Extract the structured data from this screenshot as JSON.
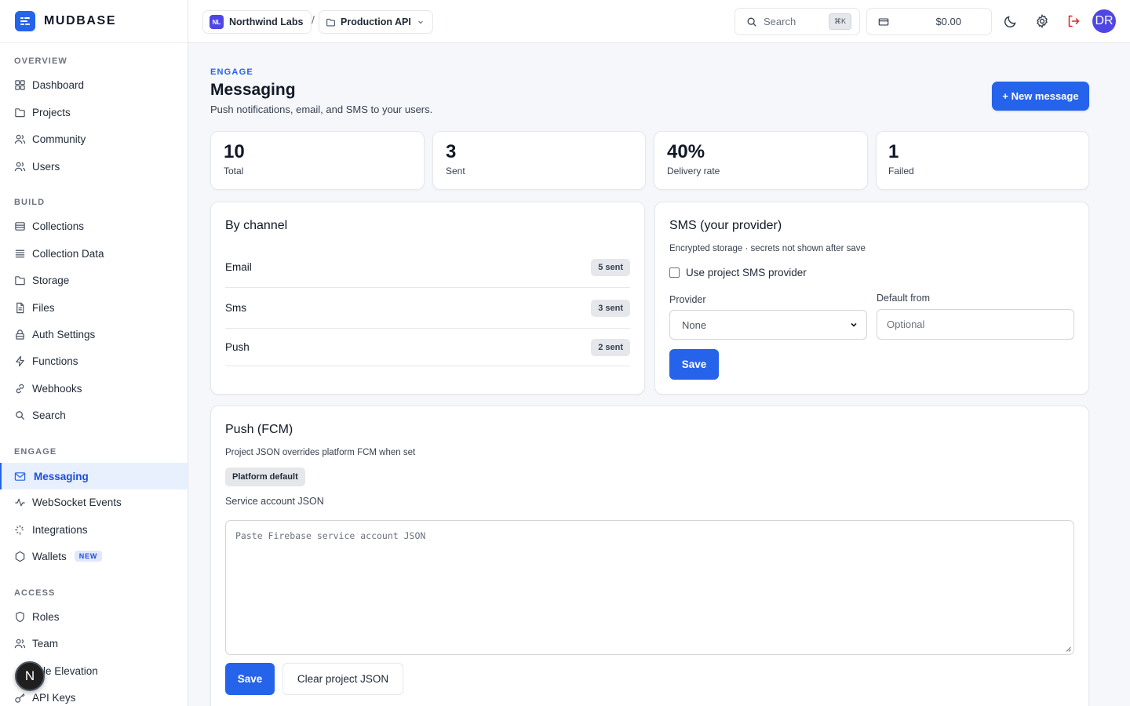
{
  "app": {
    "name": "MUDBASE"
  },
  "sidebar": {
    "sections": [
      {
        "title": "OVERVIEW",
        "items": [
          {
            "label": "Dashboard",
            "icon": "grid-icon"
          },
          {
            "label": "Projects",
            "icon": "folder-icon"
          },
          {
            "label": "Community",
            "icon": "users-icon"
          },
          {
            "label": "Users",
            "icon": "users-icon"
          }
        ]
      },
      {
        "title": "BUILD",
        "items": [
          {
            "label": "Collections",
            "icon": "database-icon"
          },
          {
            "label": "Collection Data",
            "icon": "list-icon"
          },
          {
            "label": "Storage",
            "icon": "folder-icon"
          },
          {
            "label": "Files",
            "icon": "file-icon"
          },
          {
            "label": "Auth Settings",
            "icon": "lock-icon"
          },
          {
            "label": "Functions",
            "icon": "bolt-icon"
          },
          {
            "label": "Webhooks",
            "icon": "link-icon"
          },
          {
            "label": "Search",
            "icon": "search-icon"
          }
        ]
      },
      {
        "title": "ENGAGE",
        "items": [
          {
            "label": "Messaging",
            "icon": "mail-icon",
            "active": true
          },
          {
            "label": "WebSocket Events",
            "icon": "activity-icon"
          },
          {
            "label": "Integrations",
            "icon": "plug-icon"
          },
          {
            "label": "Wallets",
            "icon": "hexagon-icon",
            "badge": "NEW"
          }
        ]
      },
      {
        "title": "ACCESS",
        "items": [
          {
            "label": "Roles",
            "icon": "shield-icon"
          },
          {
            "label": "Team",
            "icon": "users-icon"
          },
          {
            "label": "le Elevation",
            "icon": "arrow-up-icon"
          },
          {
            "label": "API Keys",
            "icon": "key-icon"
          }
        ]
      }
    ],
    "floating_avatar": "N"
  },
  "topbar": {
    "org": {
      "initials": "NL",
      "name": "Northwind Labs"
    },
    "separator": "/",
    "project": "Production API",
    "search": {
      "placeholder": "Search",
      "shortcut": "⌘K"
    },
    "balance": "$0.00",
    "user_initials": "DR"
  },
  "page": {
    "eyebrow": "ENGAGE",
    "title": "Messaging",
    "subtitle": "Push notifications, email, and SMS to your users.",
    "new_button": "+ New message"
  },
  "stats": [
    {
      "value": "10",
      "label": "Total"
    },
    {
      "value": "3",
      "label": "Sent"
    },
    {
      "value": "40%",
      "label": "Delivery rate"
    },
    {
      "value": "1",
      "label": "Failed"
    }
  ],
  "by_channel": {
    "title": "By channel",
    "rows": [
      {
        "name": "Email",
        "count": "5 sent"
      },
      {
        "name": "Sms",
        "count": "3 sent"
      },
      {
        "name": "Push",
        "count": "2 sent"
      }
    ]
  },
  "sms": {
    "title": "SMS (your provider)",
    "note": "Encrypted storage · secrets not shown after save",
    "checkbox_label": "Use project SMS provider",
    "checkbox_checked": false,
    "provider_label": "Provider",
    "provider_value": "None",
    "default_from_label": "Default from",
    "default_from_placeholder": "Optional",
    "save_label": "Save"
  },
  "push": {
    "title": "Push (FCM)",
    "note": "Project JSON overrides platform FCM when set",
    "status_pill": "Platform default",
    "json_label": "Service account JSON",
    "json_placeholder": "Paste Firebase service account JSON",
    "save_label": "Save",
    "clear_label": "Clear project JSON"
  },
  "colors": {
    "accent": "#2563eb",
    "active_bg": "#e8f0fe",
    "logout": "#dc2626",
    "avatar": "#4f46e5"
  }
}
